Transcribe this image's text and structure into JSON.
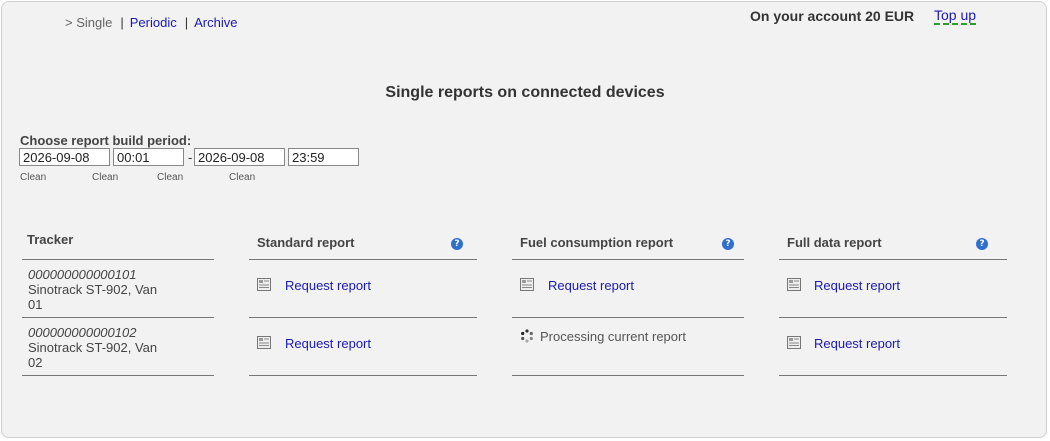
{
  "nav": {
    "current": "> Single",
    "sep1": "|",
    "periodic": "Periodic",
    "sep2": "|",
    "archive": "Archive"
  },
  "account": {
    "balance_text": "On your account 20 EUR",
    "topup_label": "Top up"
  },
  "page_title": "Single reports on connected devices",
  "period": {
    "label": "Choose report build period:",
    "start_date": "2026-09-08",
    "start_time": "00:01",
    "separator": "-",
    "end_date": "2026-09-08",
    "end_time": "23:59",
    "clean_label": "Clean"
  },
  "table": {
    "headers": {
      "tracker": "Tracker",
      "standard": "Standard report",
      "fuel": "Fuel consumption report",
      "full": "Full data report"
    },
    "help_glyph": "?",
    "rows": [
      {
        "id": "000000000000101",
        "name": "Sinotrack ST-902, Van 01",
        "standard": "Request report",
        "fuel": "Request report",
        "full": "Request report"
      },
      {
        "id": "000000000000102",
        "name": "Sinotrack ST-902, Van 02",
        "standard": "Request report",
        "fuel": "Processing current report",
        "full": "Request report"
      }
    ]
  },
  "icons": {
    "doc": "report-document-icon",
    "spinner": "loading-spinner-icon",
    "help": "help-icon"
  },
  "colors": {
    "link": "#1a1ab0",
    "help_icon": "#2f6fd0",
    "topup_underline": "#2aa02a",
    "background": "#f2f2f2"
  }
}
